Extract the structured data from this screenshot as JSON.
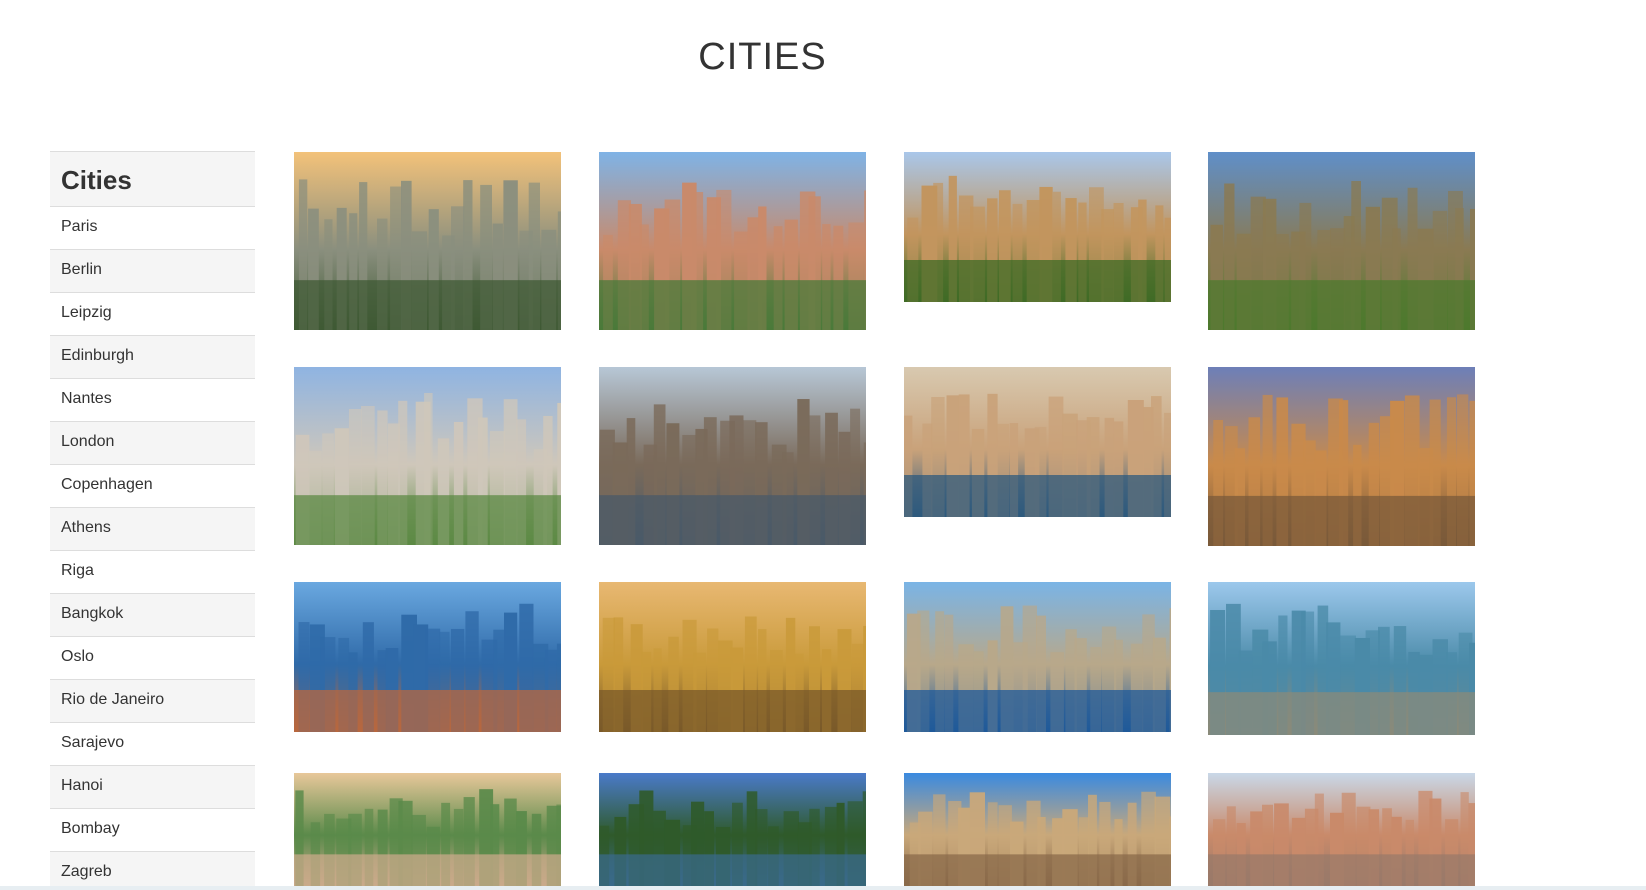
{
  "page": {
    "title": "CITIES"
  },
  "sidebar": {
    "heading": "Cities",
    "items": [
      {
        "label": "Paris"
      },
      {
        "label": "Berlin"
      },
      {
        "label": "Leipzig"
      },
      {
        "label": "Edinburgh"
      },
      {
        "label": "Nantes"
      },
      {
        "label": "London"
      },
      {
        "label": "Copenhagen"
      },
      {
        "label": "Athens"
      },
      {
        "label": "Riga"
      },
      {
        "label": "Bangkok"
      },
      {
        "label": "Oslo"
      },
      {
        "label": "Rio de Janeiro"
      },
      {
        "label": "Sarajevo"
      },
      {
        "label": "Hanoi"
      },
      {
        "label": "Bombay"
      },
      {
        "label": "Zagreb"
      }
    ]
  },
  "gallery": [
    {
      "city": "paris",
      "colors": {
        "sky": "#f3c27a",
        "mid": "#8a8f7e",
        "ground": "#3f5a34"
      }
    },
    {
      "city": "berlin",
      "colors": {
        "sky": "#7fb3e6",
        "mid": "#c98a6a",
        "ground": "#4a7a3a"
      }
    },
    {
      "city": "leipzig",
      "colors": {
        "sky": "#a9c7ea",
        "mid": "#c2955e",
        "ground": "#3f6b26"
      }
    },
    {
      "city": "edinburgh",
      "colors": {
        "sky": "#5f8fc9",
        "mid": "#8a7a52",
        "ground": "#4d7a2e"
      }
    },
    {
      "city": "nantes",
      "colors": {
        "sky": "#8fb4e2",
        "mid": "#cfc7ba",
        "ground": "#5c8a44"
      }
    },
    {
      "city": "london",
      "colors": {
        "sky": "#b7c7d6",
        "mid": "#7a6a5a",
        "ground": "#4a5a68"
      }
    },
    {
      "city": "copenhagen",
      "colors": {
        "sky": "#d8c9b0",
        "mid": "#c9a27a",
        "ground": "#2e5a7e"
      }
    },
    {
      "city": "athens",
      "colors": {
        "sky": "#6d7fb8",
        "mid": "#c98a4a",
        "ground": "#7a5a3a"
      }
    },
    {
      "city": "riga",
      "colors": {
        "sky": "#6aa8e0",
        "mid": "#2f6aa8",
        "ground": "#b8673e"
      }
    },
    {
      "city": "bangkok",
      "colors": {
        "sky": "#e8b872",
        "mid": "#c99a3a",
        "ground": "#7a5a2a"
      }
    },
    {
      "city": "oslo",
      "colors": {
        "sky": "#7ab4e6",
        "mid": "#b8a88a",
        "ground": "#1f5a9a"
      }
    },
    {
      "city": "rio-de-janeiro",
      "colors": {
        "sky": "#9cc8ec",
        "mid": "#4a8aa8",
        "ground": "#8a8a7a"
      }
    },
    {
      "city": "sarajevo",
      "colors": {
        "sky": "#e8c89a",
        "mid": "#5a8a4a",
        "ground": "#c9aa8a"
      }
    },
    {
      "city": "hanoi",
      "colors": {
        "sky": "#4a7ac9",
        "mid": "#2f5a2a",
        "ground": "#3a6a8a"
      }
    },
    {
      "city": "bombay",
      "colors": {
        "sky": "#3a8ae0",
        "mid": "#c9a87a",
        "ground": "#8a6a4a"
      }
    },
    {
      "city": "zagreb",
      "colors": {
        "sky": "#c9d8e8",
        "mid": "#c98a6a",
        "ground": "#9a7a6a"
      }
    }
  ]
}
